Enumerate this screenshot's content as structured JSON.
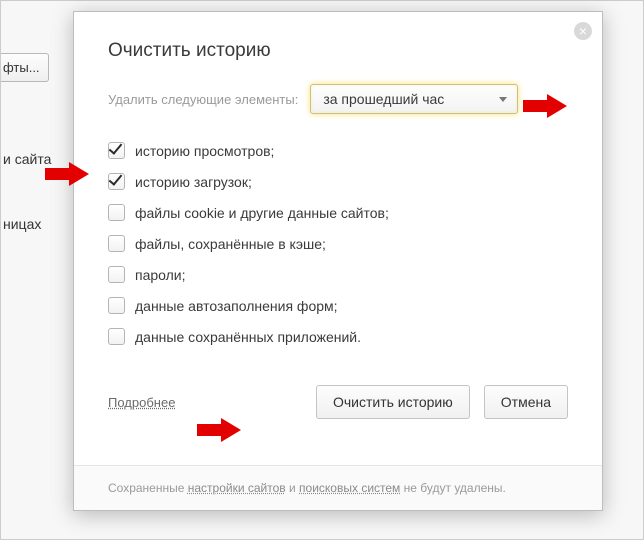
{
  "background": {
    "button": "фты...",
    "link1": "и сайта",
    "link2": "ницах"
  },
  "dialog": {
    "title": "Очистить историю",
    "delete_label": "Удалить следующие элементы:",
    "period_selected": "за прошедший час",
    "items": [
      {
        "label": "историю просмотров;",
        "checked": true
      },
      {
        "label": "историю загрузок;",
        "checked": true
      },
      {
        "label": "файлы cookie и другие данные сайтов;",
        "checked": false
      },
      {
        "label": "файлы, сохранённые в кэше;",
        "checked": false
      },
      {
        "label": "пароли;",
        "checked": false
      },
      {
        "label": "данные автозаполнения форм;",
        "checked": false
      },
      {
        "label": "данные сохранённых приложений.",
        "checked": false
      }
    ],
    "more": "Подробнее",
    "clear_btn": "Очистить историю",
    "cancel_btn": "Отмена",
    "footer_pre": "Сохраненные ",
    "footer_l1": "настройки сайтов",
    "footer_mid": " и ",
    "footer_l2": "поисковых систем",
    "footer_post": " не будут удалены."
  }
}
